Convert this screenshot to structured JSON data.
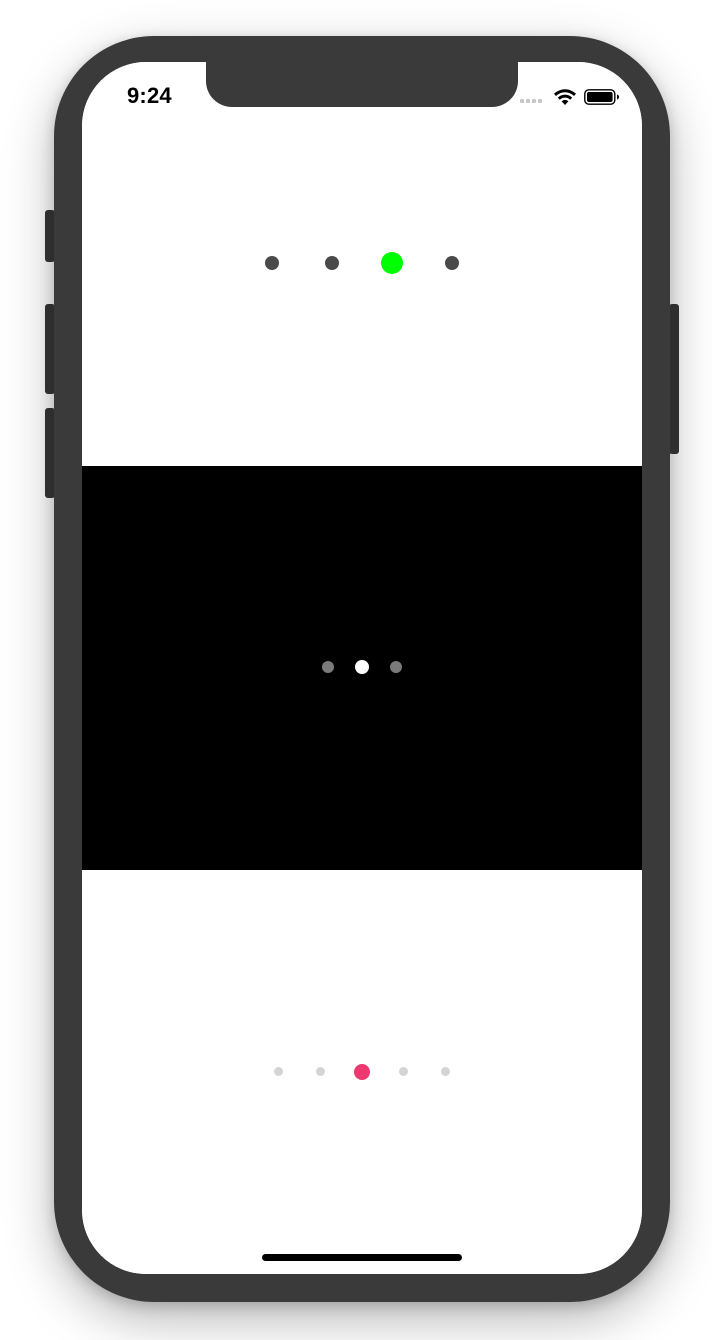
{
  "status_bar": {
    "time": "9:24"
  },
  "page_controls": [
    {
      "name": "top",
      "background": "#ffffff",
      "current_page": 3,
      "page_count": 4,
      "active_color": "#00ff00",
      "inactive_color": "#4a4a4a"
    },
    {
      "name": "middle",
      "background": "#000000",
      "current_page": 2,
      "page_count": 3,
      "active_color": "#ffffff",
      "inactive_color": "#7a7a7a"
    },
    {
      "name": "bottom",
      "background": "#ffffff",
      "current_page": 3,
      "page_count": 5,
      "active_color": "#ee3870",
      "inactive_color": "#d4d4d4"
    }
  ]
}
